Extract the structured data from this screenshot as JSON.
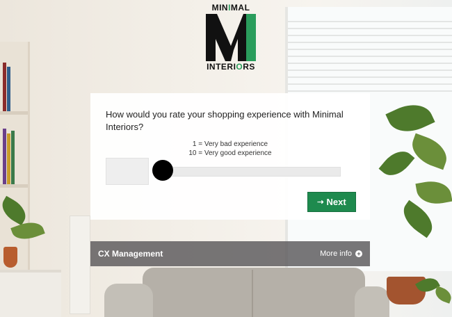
{
  "logo": {
    "top": {
      "pre": "MIN",
      "accent": "I",
      "post": "MAL"
    },
    "bottom": {
      "pre": "INTERI",
      "accent": "O",
      "post": "RS"
    }
  },
  "survey": {
    "question": "How would you rate your shopping experience with Minimal Interiors?",
    "scale_low": "1 = Very bad experience",
    "scale_high": "10 = Very good experience",
    "value": "",
    "slider_level": 0,
    "next_label": "Next"
  },
  "footer": {
    "title": "CX Management",
    "more_label": "More info"
  },
  "colors": {
    "accent": "#1e8a4e",
    "logo_green": "#2a9d5c"
  }
}
